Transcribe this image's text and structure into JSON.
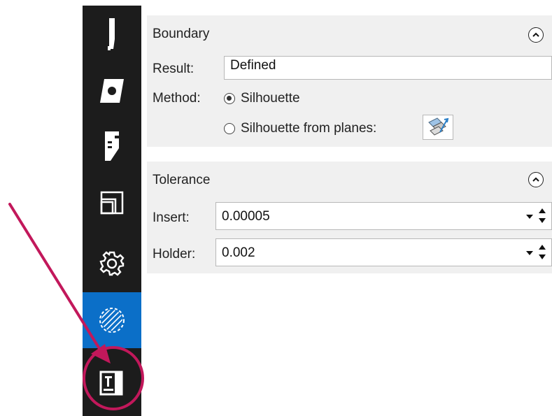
{
  "toolbar": {
    "items": [
      {
        "name": "tool"
      },
      {
        "name": "insert"
      },
      {
        "name": "holder"
      },
      {
        "name": "setup"
      },
      {
        "name": "settings"
      },
      {
        "name": "boundary",
        "active": true
      },
      {
        "name": "machine"
      }
    ],
    "active_color": "#0b6fc8"
  },
  "boundary": {
    "title": "Boundary",
    "result_label": "Result:",
    "result_value": "Defined",
    "method_label": "Method:",
    "method_options": [
      "Silhouette",
      "Silhouette from planes:"
    ],
    "method_selected": "Silhouette"
  },
  "tolerance": {
    "title": "Tolerance",
    "insert_label": "Insert:",
    "insert_value": "0.00005",
    "holder_label": "Holder:",
    "holder_value": "0.002"
  },
  "annotation": {
    "arrow_color": "#c2185b",
    "circle_color": "#c2185b"
  }
}
